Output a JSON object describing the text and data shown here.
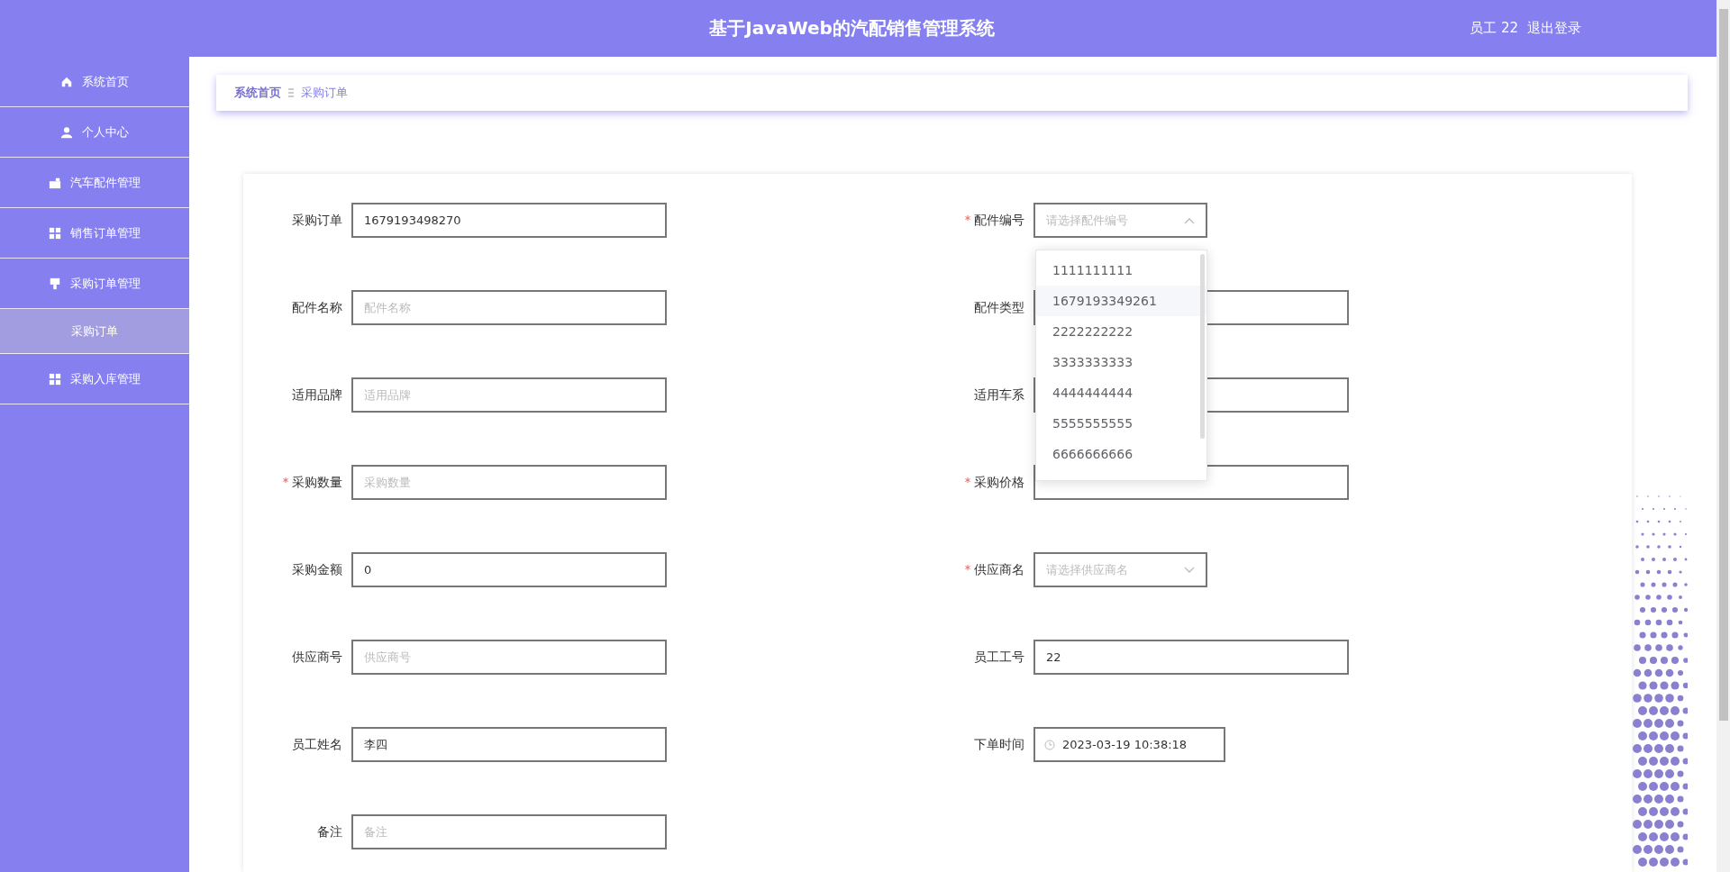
{
  "header": {
    "title": "基于JavaWeb的汽配销售管理系统",
    "user": "员工 22",
    "logout": "退出登录"
  },
  "sidebar": {
    "items": [
      {
        "label": "系统首页",
        "selected": false
      },
      {
        "label": "个人中心",
        "selected": false
      },
      {
        "label": "汽车配件管理",
        "selected": false
      },
      {
        "label": "销售订单管理",
        "selected": false
      },
      {
        "label": "采购订单管理",
        "selected": false,
        "children": [
          {
            "label": "采购订单",
            "selected": true
          }
        ]
      },
      {
        "label": "采购入库管理",
        "selected": false
      }
    ]
  },
  "breadcrumb": [
    "系统首页",
    "采购订单"
  ],
  "form": {
    "fields": [
      {
        "kind": "text",
        "label": "采购订单",
        "required": false,
        "value": "1679193498270"
      },
      {
        "kind": "select",
        "label": "配件编号",
        "required": true,
        "placeholder": "请选择配件编号",
        "open": true,
        "options": [
          {
            "label": "1111111111",
            "highlighted": false
          },
          {
            "label": "1679193349261",
            "highlighted": true
          },
          {
            "label": "2222222222",
            "highlighted": false
          },
          {
            "label": "3333333333",
            "highlighted": false
          },
          {
            "label": "4444444444",
            "highlighted": false
          },
          {
            "label": "5555555555",
            "highlighted": false
          },
          {
            "label": "6666666666",
            "highlighted": false
          }
        ]
      },
      {
        "kind": "text",
        "label": "配件名称",
        "required": false,
        "placeholder": "配件名称"
      },
      {
        "kind": "text",
        "label": "配件类型",
        "required": false
      },
      {
        "kind": "text",
        "label": "适用品牌",
        "required": false,
        "placeholder": "适用品牌"
      },
      {
        "kind": "text",
        "label": "适用车系",
        "required": false
      },
      {
        "kind": "text",
        "label": "采购数量",
        "required": true,
        "placeholder": "采购数量"
      },
      {
        "kind": "text",
        "label": "采购价格",
        "required": true
      },
      {
        "kind": "text",
        "label": "采购金额",
        "required": false,
        "value": "0"
      },
      {
        "kind": "select",
        "label": "供应商名",
        "required": true,
        "placeholder": "请选择供应商名",
        "open": false
      },
      {
        "kind": "text",
        "label": "供应商号",
        "required": false,
        "placeholder": "供应商号"
      },
      {
        "kind": "text",
        "label": "员工工号",
        "required": false,
        "value": "22"
      },
      {
        "kind": "text",
        "label": "员工姓名",
        "required": false,
        "value": "李四"
      },
      {
        "kind": "date",
        "label": "下单时间",
        "required": false,
        "value": "2023-03-19 10:38:18"
      },
      {
        "kind": "text",
        "label": "备注",
        "required": false,
        "placeholder": "备注"
      }
    ]
  }
}
